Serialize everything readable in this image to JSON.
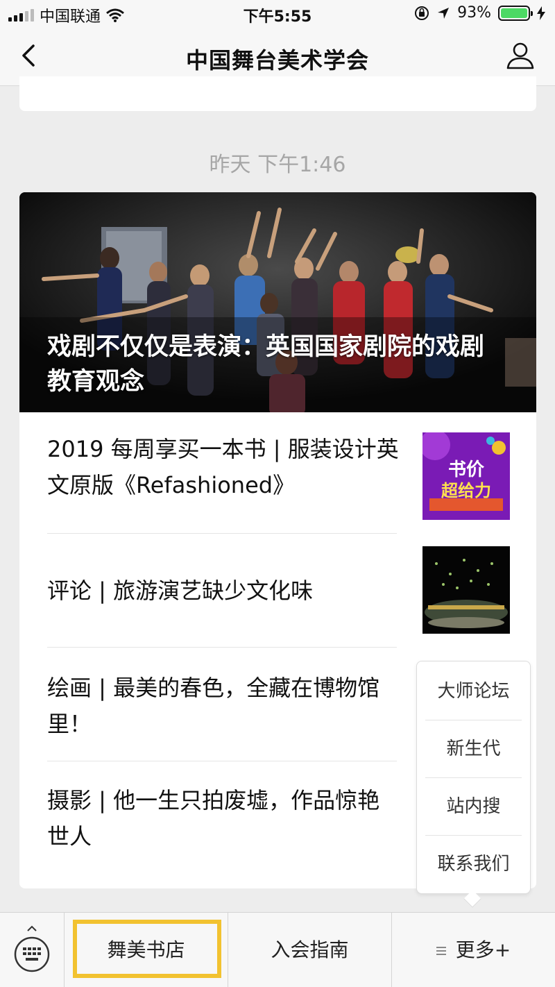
{
  "status_bar": {
    "carrier": "中国联通",
    "time": "下午5:55",
    "battery": "93%",
    "battery_level": 0.93
  },
  "nav": {
    "title": "中国舞台美术学会",
    "back_icon": "chevron-left-icon",
    "profile_icon": "user-icon"
  },
  "timestamp": "昨天 下午1:46",
  "article": {
    "cover_title": "戏剧不仅仅是表演：英国国家剧院的戏剧教育观念",
    "items": [
      {
        "title": "2019 每周享买一本书 | 服装设计英文原版《Refashioned》"
      },
      {
        "title": "评论 | 旅游演艺缺少文化味"
      },
      {
        "title": "绘画 | 最美的春色，全藏在博物馆里！"
      },
      {
        "title": "摄影 | 他一生只拍废墟，作品惊艳世人"
      }
    ]
  },
  "thumbnail_text": "书价 超给力",
  "popup_menu": {
    "items": [
      "大师论坛",
      "新生代",
      "站内搜",
      "联系我们"
    ]
  },
  "bottom_menu": {
    "keyboard_icon": "keyboard-icon",
    "items": [
      "舞美书店",
      "入会指南",
      "更多+"
    ]
  },
  "colors": {
    "highlight": "#f2c230",
    "battery": "#4cd964",
    "background": "#ededed"
  }
}
